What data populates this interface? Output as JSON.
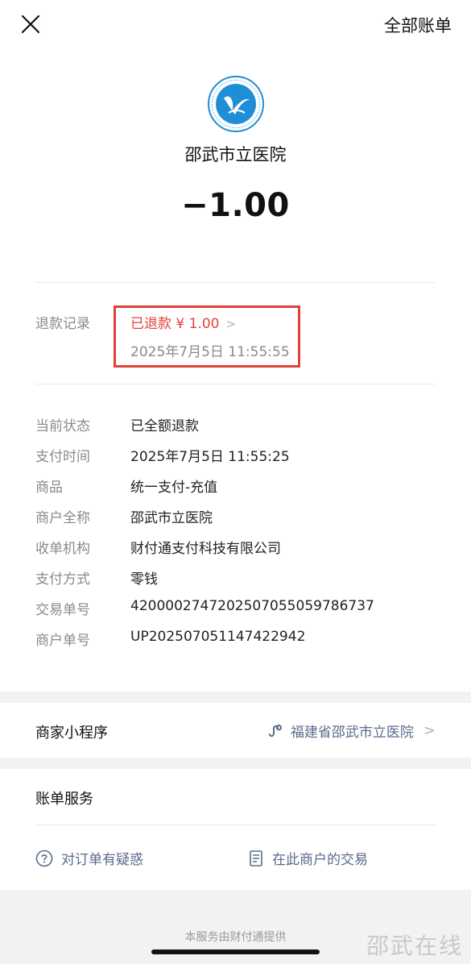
{
  "header": {
    "close_icon": "close-icon",
    "all_bills_label": "全部账单"
  },
  "merchant": {
    "logo_icon": "hospital-logo",
    "name": "邵武市立医院",
    "amount": "−1.00"
  },
  "refund": {
    "label": "退款记录",
    "status": "已退款 ¥ 1.00",
    "time": "2025年7月5日 11:55:55",
    "highlight_color": "#e0413b"
  },
  "details": [
    {
      "label": "当前状态",
      "value": "已全额退款"
    },
    {
      "label": "支付时间",
      "value": "2025年7月5日 11:55:25"
    },
    {
      "label": "商品",
      "value": "统一支付-充值"
    },
    {
      "label": "商户全称",
      "value": "邵武市立医院"
    },
    {
      "label": "收单机构",
      "value": "财付通支付科技有限公司"
    },
    {
      "label": "支付方式",
      "value": "零钱"
    },
    {
      "label": "交易单号",
      "value": "4200002747202507055059786737"
    },
    {
      "label": "商户单号",
      "value": "UP202507051147422942"
    }
  ],
  "mini_program": {
    "label": "商家小程序",
    "link_text": "福建省邵武市立医院",
    "icon": "mini-program-icon"
  },
  "bill_service": {
    "title": "账单服务",
    "question_label": "对订单有疑惑",
    "merchant_trades_label": "在此商户的交易"
  },
  "footer": {
    "provider_text": "本服务由财付通提供",
    "watermark": "邵武在线"
  }
}
